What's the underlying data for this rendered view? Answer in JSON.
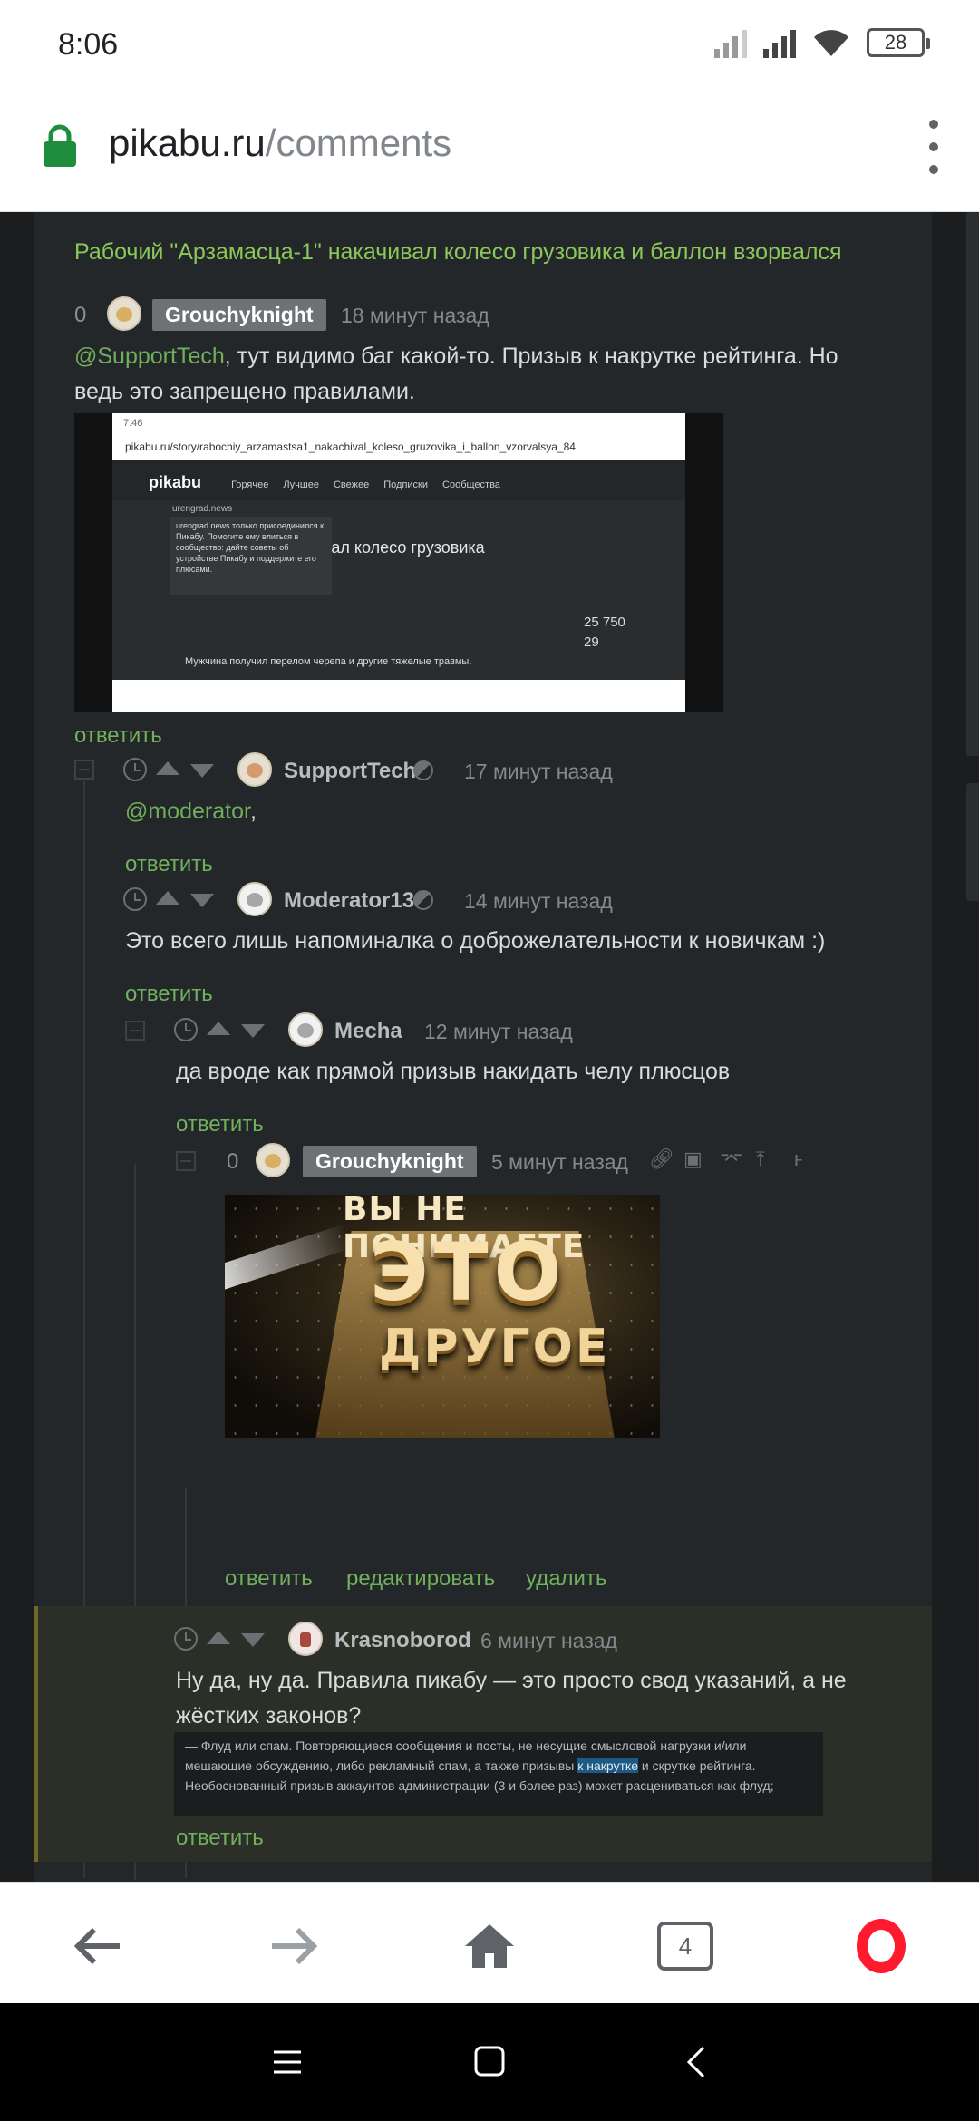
{
  "status_bar": {
    "time": "8:06",
    "battery": "28"
  },
  "url_bar": {
    "domain": "pikabu.ru",
    "path": "/comments"
  },
  "post": {
    "title": "Рабочий \"Арзамасца-1\" накачивал колесо грузовика и баллон взорвался"
  },
  "comments": [
    {
      "score": "0",
      "author": "Grouchyknight",
      "time": "18 минут назад",
      "mention": "@SupportTech",
      "text": ", тут видимо баг какой-то. Призыв к накрутке рейтинга. Но ведь это запрещено правилами.",
      "reply": "ответить",
      "image": {
        "time": "7:46",
        "url": "pikabu.ru/story/rabochiy_arzamastsa1_nakachival_koleso_gruzovika_i_ballon_vzorvalsya_84",
        "logo": "pikabu",
        "nav": [
          "Горячее",
          "Лучшее",
          "Свежее",
          "Подписки",
          "Сообщества"
        ],
        "user": "urengrad.news",
        "tip": "urengrad.news только присоединился к Пикабу. Помогите ему влиться в сообщество: дайте советы об устройстве Пикабу и поддержите его плюсами.",
        "post_fragment": "ивал колесо грузовика",
        "stats": [
          "25 750",
          "29"
        ],
        "news": "Мужчина получил перелом черепа и другие тяжелые травмы."
      }
    },
    {
      "author": "SupportTech",
      "time": "17 минут назад",
      "mention": "@moderator",
      "text": ",",
      "reply": "ответить"
    },
    {
      "author": "Moderator13",
      "time": "14 минут назад",
      "text": "Это всего лишь напоминалка о доброжелательности к новичкам :)",
      "reply": "ответить"
    },
    {
      "author": "Mecha",
      "time": "12 минут назад",
      "text": "да вроде как прямой призыв накидать челу плюсцов",
      "reply": "ответить"
    },
    {
      "score": "0",
      "author": "Grouchyknight",
      "time": "5 минут назад",
      "image": {
        "line1": "ВЫ НЕ ПОНИМАЕТЕ",
        "line2": "ЭТО",
        "line3": "ДРУГОЕ"
      },
      "reply": "ответить",
      "edit": "редактировать",
      "delete": "удалить"
    },
    {
      "author": "Krasnoborod",
      "time": "6 минут назад",
      "text": "Ну да, ну да. Правила пикабу — это просто свод указаний, а не жёстких законов?",
      "rules_before": "— Флуд или спам. Повторяющиеся сообщения и посты, не несущие смысловой нагрузки и/или мешающие обсуждению, либо рекламный спам, а также призывы ",
      "rules_mark": "к накрутке",
      "rules_after": " и скрутке рейтинга. Необоснованный призыв аккаунтов администрации (3 и более раз) может расцениваться как флуд;",
      "reply": "ответить"
    }
  ],
  "toolbar": {
    "tab_count": "4"
  },
  "colors": {
    "accent_green": "#8ac858",
    "page_bg": "#1b1d1f",
    "card_bg": "#24272a",
    "opera_red": "#ff1b2d"
  }
}
